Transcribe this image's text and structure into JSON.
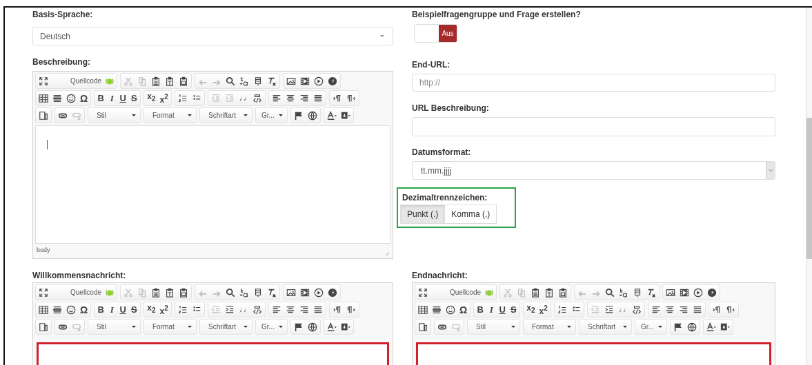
{
  "base_language": {
    "label": "Basis-Sprache:",
    "value": "Deutsch"
  },
  "sample_question": {
    "label": "Beispielfragengruppe und Frage erstellen?",
    "on": false,
    "off_label": "Aus"
  },
  "description_editor": {
    "label": "Beschreibung:",
    "highlighted": false,
    "cursor": true,
    "status": "body",
    "toolbar": [
      [
        [
          {
            "kind": "icon",
            "disabled": false
          },
          {
            "kind": "source",
            "label": "Quellcode",
            "disabled": false
          }
        ],
        [
          {
            "kind": "icon",
            "disabled": true
          },
          {
            "kind": "icon",
            "disabled": true
          },
          {
            "kind": "icon",
            "disabled": false
          },
          {
            "kind": "icon",
            "disabled": false
          },
          {
            "kind": "icon",
            "disabled": false
          }
        ],
        [
          {
            "kind": "icon",
            "disabled": true
          },
          {
            "kind": "icon",
            "disabled": true
          },
          {
            "kind": "icon",
            "disabled": false
          },
          {
            "kind": "icon",
            "disabled": false
          },
          {
            "kind": "icon",
            "disabled": false
          },
          {
            "kind": "icon",
            "disabled": false
          }
        ],
        [
          {
            "kind": "icon",
            "disabled": false
          },
          {
            "kind": "icon",
            "disabled": false
          },
          {
            "kind": "icon",
            "disabled": false
          },
          {
            "kind": "icon",
            "disabled": false
          }
        ]
      ],
      [
        [
          {
            "kind": "icon",
            "disabled": false
          },
          {
            "kind": "icon",
            "disabled": false
          },
          {
            "kind": "icon",
            "disabled": false
          },
          {
            "kind": "glyph",
            "label": "Ω",
            "disabled": false
          }
        ],
        [
          {
            "kind": "glyph",
            "label": "B",
            "disabled": false
          },
          {
            "kind": "glyph",
            "label": "I",
            "disabled": false
          },
          {
            "kind": "glyph",
            "label": "U",
            "disabled": false
          },
          {
            "kind": "glyph",
            "label": "S",
            "disabled": false
          }
        ],
        [
          {
            "kind": "glyph",
            "label": "x$_{2}$",
            "disabled": false
          },
          {
            "kind": "glyph",
            "label": "x$^{2}$",
            "disabled": false
          }
        ],
        [
          {
            "kind": "icon",
            "disabled": false
          },
          {
            "kind": "icon",
            "disabled": false
          }
        ],
        [
          {
            "kind": "icon",
            "disabled": true
          },
          {
            "kind": "icon",
            "disabled": true
          },
          {
            "kind": "icon",
            "disabled": false
          },
          {
            "kind": "icon",
            "disabled": false
          }
        ],
        [
          {
            "kind": "icon",
            "disabled": false
          },
          {
            "kind": "icon",
            "disabled": false
          },
          {
            "kind": "icon",
            "disabled": false
          },
          {
            "kind": "icon",
            "disabled": false
          }
        ],
        [
          {
            "kind": "icon",
            "disabled": false
          },
          {
            "kind": "icon",
            "disabled": false
          }
        ]
      ],
      [
        [
          {
            "kind": "icon",
            "disabled": false
          }
        ],
        [
          {
            "kind": "icon",
            "disabled": false
          },
          {
            "kind": "icon",
            "disabled": true
          }
        ],
        [
          {
            "kind": "combo",
            "label": "Stil",
            "disabled": false
          }
        ],
        [
          {
            "kind": "combo",
            "label": "Format",
            "disabled": false
          }
        ],
        [
          {
            "kind": "combo",
            "label": "Schriftart",
            "disabled": false
          }
        ],
        [
          {
            "kind": "combo",
            "label": "Gr...",
            "disabled": false
          }
        ],
        [
          {
            "kind": "icon",
            "disabled": false
          },
          {
            "kind": "icon",
            "disabled": false
          }
        ],
        [
          {
            "kind": "icon",
            "disabled": false
          },
          {
            "kind": "icon",
            "disabled": false
          }
        ]
      ]
    ]
  },
  "end_url": {
    "label": "End-URL:",
    "placeholder": "http://"
  },
  "url_description": {
    "label": "URL Beschreibung:"
  },
  "date_format": {
    "label": "Datumsformat:",
    "value": "tt.mm.jjjj"
  },
  "decimal_separator": {
    "label": "Dezimaltrennzeichen:",
    "highlighted": true,
    "options": [
      {
        "label": "Punkt (.)",
        "selected": true
      },
      {
        "label": "Komma (,)",
        "selected": false
      }
    ]
  },
  "bottom_editors": [
    {
      "label": "Willkommensnachricht:",
      "highlighted": true,
      "toolbar": [
        [
          [
            {
              "kind": "icon",
              "disabled": false
            },
            {
              "kind": "source",
              "label": "Quellcode",
              "disabled": false
            }
          ],
          [
            {
              "kind": "icon",
              "disabled": true
            },
            {
              "kind": "icon",
              "disabled": true
            },
            {
              "kind": "icon",
              "disabled": false
            },
            {
              "kind": "icon",
              "disabled": false
            },
            {
              "kind": "icon",
              "disabled": false
            }
          ],
          [
            {
              "kind": "icon",
              "disabled": true
            },
            {
              "kind": "icon",
              "disabled": true
            },
            {
              "kind": "icon",
              "disabled": false
            },
            {
              "kind": "icon",
              "disabled": false
            },
            {
              "kind": "icon",
              "disabled": false
            },
            {
              "kind": "icon",
              "disabled": false
            }
          ],
          [
            {
              "kind": "icon",
              "disabled": false
            },
            {
              "kind": "icon",
              "disabled": false
            },
            {
              "kind": "icon",
              "disabled": false
            },
            {
              "kind": "icon",
              "disabled": false
            }
          ]
        ],
        [
          [
            {
              "kind": "icon",
              "disabled": false
            },
            {
              "kind": "icon",
              "disabled": false
            },
            {
              "kind": "icon",
              "disabled": false
            },
            {
              "kind": "glyph",
              "label": "Ω",
              "disabled": false
            }
          ],
          [
            {
              "kind": "glyph",
              "label": "B",
              "disabled": false
            },
            {
              "kind": "glyph",
              "label": "I",
              "disabled": false
            },
            {
              "kind": "glyph",
              "label": "U",
              "disabled": false
            },
            {
              "kind": "glyph",
              "label": "S",
              "disabled": false
            }
          ],
          [
            {
              "kind": "glyph",
              "label": "x$_{2}$",
              "disabled": false
            },
            {
              "kind": "glyph",
              "label": "x$^{2}$",
              "disabled": false
            }
          ],
          [
            {
              "kind": "icon",
              "disabled": false
            },
            {
              "kind": "icon",
              "disabled": false
            }
          ],
          [
            {
              "kind": "icon",
              "disabled": true
            },
            {
              "kind": "icon",
              "disabled": false
            },
            {
              "kind": "icon",
              "disabled": false
            },
            {
              "kind": "icon",
              "disabled": false
            }
          ],
          [
            {
              "kind": "icon",
              "disabled": false
            },
            {
              "kind": "icon",
              "disabled": false
            },
            {
              "kind": "icon",
              "disabled": false
            },
            {
              "kind": "icon",
              "disabled": false
            }
          ],
          [
            {
              "kind": "icon",
              "disabled": false
            },
            {
              "kind": "icon",
              "disabled": false
            }
          ]
        ],
        [
          [
            {
              "kind": "icon",
              "disabled": false
            }
          ],
          [
            {
              "kind": "icon",
              "disabled": false
            },
            {
              "kind": "icon",
              "disabled": true
            }
          ],
          [
            {
              "kind": "combo",
              "label": "Stil",
              "disabled": false
            }
          ],
          [
            {
              "kind": "combo",
              "label": "Format",
              "disabled": false
            }
          ],
          [
            {
              "kind": "combo",
              "label": "Schriftart",
              "disabled": false
            }
          ],
          [
            {
              "kind": "combo",
              "label": "Gr...",
              "disabled": false
            }
          ],
          [
            {
              "kind": "icon",
              "disabled": false
            },
            {
              "kind": "icon",
              "disabled": false
            }
          ],
          [
            {
              "kind": "icon",
              "disabled": false
            },
            {
              "kind": "icon",
              "disabled": false
            }
          ]
        ]
      ]
    },
    {
      "label": "Endnachricht:",
      "highlighted": true,
      "toolbar": [
        [
          [
            {
              "kind": "icon",
              "disabled": false
            },
            {
              "kind": "source",
              "label": "Quellcode",
              "disabled": false
            }
          ],
          [
            {
              "kind": "icon",
              "disabled": true
            },
            {
              "kind": "icon",
              "disabled": true
            },
            {
              "kind": "icon",
              "disabled": false
            },
            {
              "kind": "icon",
              "disabled": false
            },
            {
              "kind": "icon",
              "disabled": false
            }
          ],
          [
            {
              "kind": "icon",
              "disabled": true
            },
            {
              "kind": "icon",
              "disabled": true
            },
            {
              "kind": "icon",
              "disabled": false
            },
            {
              "kind": "icon",
              "disabled": false
            },
            {
              "kind": "icon",
              "disabled": false
            },
            {
              "kind": "icon",
              "disabled": false
            }
          ],
          [
            {
              "kind": "icon",
              "disabled": false
            },
            {
              "kind": "icon",
              "disabled": false
            },
            {
              "kind": "icon",
              "disabled": false
            },
            {
              "kind": "icon",
              "disabled": false
            }
          ]
        ],
        [
          [
            {
              "kind": "icon",
              "disabled": false
            },
            {
              "kind": "icon",
              "disabled": false
            },
            {
              "kind": "icon",
              "disabled": false
            },
            {
              "kind": "glyph",
              "label": "Ω",
              "disabled": false
            }
          ],
          [
            {
              "kind": "glyph",
              "label": "B",
              "disabled": false
            },
            {
              "kind": "glyph",
              "label": "I",
              "disabled": false
            },
            {
              "kind": "glyph",
              "label": "U",
              "disabled": false
            },
            {
              "kind": "glyph",
              "label": "S",
              "disabled": false
            }
          ],
          [
            {
              "kind": "glyph",
              "label": "x$_{2}$",
              "disabled": false
            },
            {
              "kind": "glyph",
              "label": "x$^{2}$",
              "disabled": false
            }
          ],
          [
            {
              "kind": "icon",
              "disabled": false
            },
            {
              "kind": "icon",
              "disabled": false
            }
          ],
          [
            {
              "kind": "icon",
              "disabled": true
            },
            {
              "kind": "icon",
              "disabled": false
            },
            {
              "kind": "icon",
              "disabled": false
            },
            {
              "kind": "icon",
              "disabled": false
            }
          ],
          [
            {
              "kind": "icon",
              "disabled": false
            },
            {
              "kind": "icon",
              "disabled": false
            },
            {
              "kind": "icon",
              "disabled": false
            },
            {
              "kind": "icon",
              "disabled": false
            }
          ],
          [
            {
              "kind": "icon",
              "disabled": false
            },
            {
              "kind": "icon",
              "disabled": false
            }
          ]
        ],
        [
          [
            {
              "kind": "icon",
              "disabled": false
            }
          ],
          [
            {
              "kind": "icon",
              "disabled": false
            },
            {
              "kind": "icon",
              "disabled": true
            }
          ],
          [
            {
              "kind": "combo",
              "label": "Stil",
              "disabled": false
            }
          ],
          [
            {
              "kind": "combo",
              "label": "Format",
              "disabled": false
            }
          ],
          [
            {
              "kind": "combo",
              "label": "Schriftart",
              "disabled": false
            }
          ],
          [
            {
              "kind": "combo",
              "label": "Gr...",
              "disabled": false
            }
          ],
          [
            {
              "kind": "icon",
              "disabled": false
            },
            {
              "kind": "icon",
              "disabled": false
            }
          ],
          [
            {
              "kind": "icon",
              "disabled": false
            },
            {
              "kind": "icon",
              "disabled": false
            }
          ]
        ]
      ]
    }
  ]
}
